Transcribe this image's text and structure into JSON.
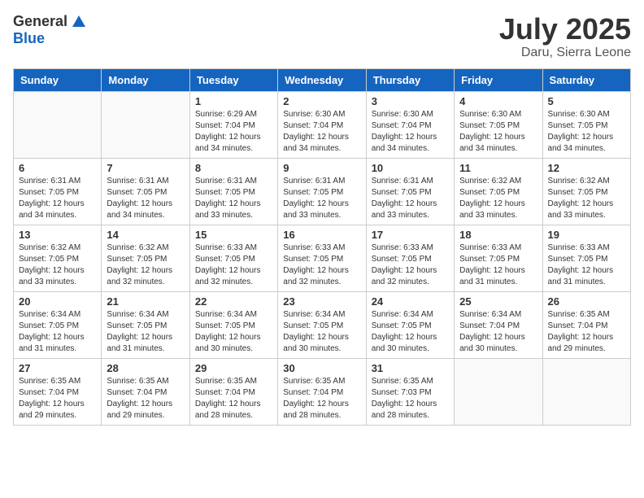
{
  "logo": {
    "general": "General",
    "blue": "Blue"
  },
  "title": {
    "month_year": "July 2025",
    "location": "Daru, Sierra Leone"
  },
  "days_of_week": [
    "Sunday",
    "Monday",
    "Tuesday",
    "Wednesday",
    "Thursday",
    "Friday",
    "Saturday"
  ],
  "weeks": [
    [
      {
        "day": "",
        "info": ""
      },
      {
        "day": "",
        "info": ""
      },
      {
        "day": "1",
        "info": "Sunrise: 6:29 AM\nSunset: 7:04 PM\nDaylight: 12 hours and 34 minutes."
      },
      {
        "day": "2",
        "info": "Sunrise: 6:30 AM\nSunset: 7:04 PM\nDaylight: 12 hours and 34 minutes."
      },
      {
        "day": "3",
        "info": "Sunrise: 6:30 AM\nSunset: 7:04 PM\nDaylight: 12 hours and 34 minutes."
      },
      {
        "day": "4",
        "info": "Sunrise: 6:30 AM\nSunset: 7:05 PM\nDaylight: 12 hours and 34 minutes."
      },
      {
        "day": "5",
        "info": "Sunrise: 6:30 AM\nSunset: 7:05 PM\nDaylight: 12 hours and 34 minutes."
      }
    ],
    [
      {
        "day": "6",
        "info": "Sunrise: 6:31 AM\nSunset: 7:05 PM\nDaylight: 12 hours and 34 minutes."
      },
      {
        "day": "7",
        "info": "Sunrise: 6:31 AM\nSunset: 7:05 PM\nDaylight: 12 hours and 34 minutes."
      },
      {
        "day": "8",
        "info": "Sunrise: 6:31 AM\nSunset: 7:05 PM\nDaylight: 12 hours and 33 minutes."
      },
      {
        "day": "9",
        "info": "Sunrise: 6:31 AM\nSunset: 7:05 PM\nDaylight: 12 hours and 33 minutes."
      },
      {
        "day": "10",
        "info": "Sunrise: 6:31 AM\nSunset: 7:05 PM\nDaylight: 12 hours and 33 minutes."
      },
      {
        "day": "11",
        "info": "Sunrise: 6:32 AM\nSunset: 7:05 PM\nDaylight: 12 hours and 33 minutes."
      },
      {
        "day": "12",
        "info": "Sunrise: 6:32 AM\nSunset: 7:05 PM\nDaylight: 12 hours and 33 minutes."
      }
    ],
    [
      {
        "day": "13",
        "info": "Sunrise: 6:32 AM\nSunset: 7:05 PM\nDaylight: 12 hours and 33 minutes."
      },
      {
        "day": "14",
        "info": "Sunrise: 6:32 AM\nSunset: 7:05 PM\nDaylight: 12 hours and 32 minutes."
      },
      {
        "day": "15",
        "info": "Sunrise: 6:33 AM\nSunset: 7:05 PM\nDaylight: 12 hours and 32 minutes."
      },
      {
        "day": "16",
        "info": "Sunrise: 6:33 AM\nSunset: 7:05 PM\nDaylight: 12 hours and 32 minutes."
      },
      {
        "day": "17",
        "info": "Sunrise: 6:33 AM\nSunset: 7:05 PM\nDaylight: 12 hours and 32 minutes."
      },
      {
        "day": "18",
        "info": "Sunrise: 6:33 AM\nSunset: 7:05 PM\nDaylight: 12 hours and 31 minutes."
      },
      {
        "day": "19",
        "info": "Sunrise: 6:33 AM\nSunset: 7:05 PM\nDaylight: 12 hours and 31 minutes."
      }
    ],
    [
      {
        "day": "20",
        "info": "Sunrise: 6:34 AM\nSunset: 7:05 PM\nDaylight: 12 hours and 31 minutes."
      },
      {
        "day": "21",
        "info": "Sunrise: 6:34 AM\nSunset: 7:05 PM\nDaylight: 12 hours and 31 minutes."
      },
      {
        "day": "22",
        "info": "Sunrise: 6:34 AM\nSunset: 7:05 PM\nDaylight: 12 hours and 30 minutes."
      },
      {
        "day": "23",
        "info": "Sunrise: 6:34 AM\nSunset: 7:05 PM\nDaylight: 12 hours and 30 minutes."
      },
      {
        "day": "24",
        "info": "Sunrise: 6:34 AM\nSunset: 7:05 PM\nDaylight: 12 hours and 30 minutes."
      },
      {
        "day": "25",
        "info": "Sunrise: 6:34 AM\nSunset: 7:04 PM\nDaylight: 12 hours and 30 minutes."
      },
      {
        "day": "26",
        "info": "Sunrise: 6:35 AM\nSunset: 7:04 PM\nDaylight: 12 hours and 29 minutes."
      }
    ],
    [
      {
        "day": "27",
        "info": "Sunrise: 6:35 AM\nSunset: 7:04 PM\nDaylight: 12 hours and 29 minutes."
      },
      {
        "day": "28",
        "info": "Sunrise: 6:35 AM\nSunset: 7:04 PM\nDaylight: 12 hours and 29 minutes."
      },
      {
        "day": "29",
        "info": "Sunrise: 6:35 AM\nSunset: 7:04 PM\nDaylight: 12 hours and 28 minutes."
      },
      {
        "day": "30",
        "info": "Sunrise: 6:35 AM\nSunset: 7:04 PM\nDaylight: 12 hours and 28 minutes."
      },
      {
        "day": "31",
        "info": "Sunrise: 6:35 AM\nSunset: 7:03 PM\nDaylight: 12 hours and 28 minutes."
      },
      {
        "day": "",
        "info": ""
      },
      {
        "day": "",
        "info": ""
      }
    ]
  ]
}
